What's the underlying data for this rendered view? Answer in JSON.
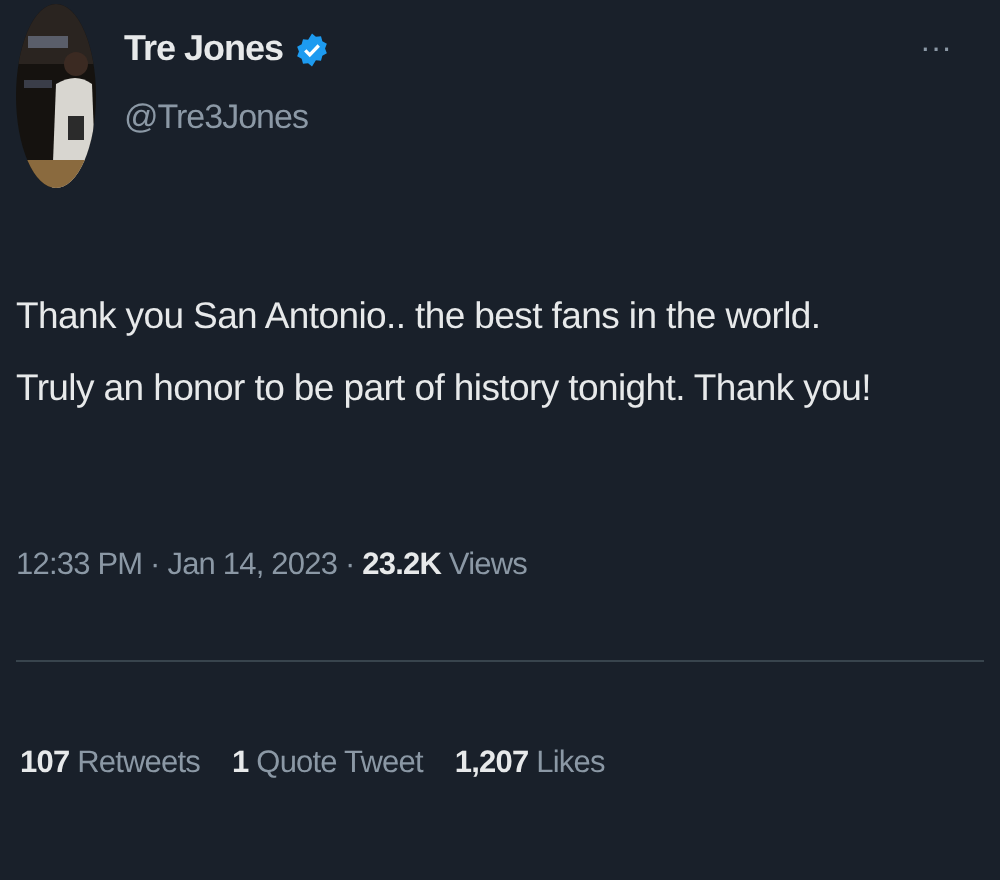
{
  "author": {
    "name": "Tre Jones",
    "verified": true,
    "handle": "@Tre3Jones"
  },
  "more": "···",
  "text": "Thank you San Antonio.. the best fans in the world.\nTruly an honor to be part of history tonight. Thank you!",
  "meta": "12:33 PM · Jan 14, 2023 · **23.2K** Views",
  "stats": [
    {
      "count": "107",
      "label": "Retweets"
    },
    {
      "count": "1",
      "label": "Quote Tweet"
    },
    {
      "count": "1,207",
      "label": "Likes"
    }
  ]
}
